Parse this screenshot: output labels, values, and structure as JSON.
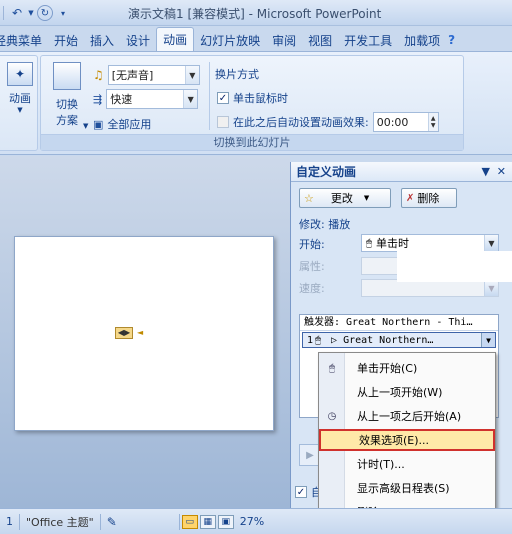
{
  "window": {
    "title": "演示文稿1 [兼容模式] - Microsoft PowerPoint"
  },
  "qat": {
    "undo_icon": "undo-icon",
    "redo_icon": "redo-icon",
    "customize_icon": "qat-dropdown-icon"
  },
  "tabs": [
    {
      "label": "经典菜单"
    },
    {
      "label": "开始"
    },
    {
      "label": "插入"
    },
    {
      "label": "设计"
    },
    {
      "label": "动画"
    },
    {
      "label": "幻灯片放映"
    },
    {
      "label": "审阅"
    },
    {
      "label": "视图"
    },
    {
      "label": "开发工具"
    },
    {
      "label": "加载项"
    }
  ],
  "active_tab": "动画",
  "ribbon": {
    "animation_btn": "动画",
    "transition_scheme_line1": "切换",
    "transition_scheme_line2": "方案",
    "sound_value": "[无声音]",
    "speed_value": "快速",
    "apply_all": "全部应用",
    "advance_title": "换片方式",
    "on_click": "单击鼠标时",
    "auto_after": "在此之后自动设置动画效果:",
    "auto_time": "00:00",
    "group_label": "切换到此幻灯片"
  },
  "pane": {
    "title": "自定义动画",
    "change_btn": "更改",
    "remove_btn": "删除",
    "modify_label": "修改: 播放",
    "start_label": "开始:",
    "start_value": "单击时",
    "property_label": "属性:",
    "speed_label": "速度:",
    "trigger_text": "触发器: Great Northern - Thi…",
    "item_index": "1",
    "item_text": "Great Northern…",
    "bottom_checkbox": "自"
  },
  "context_menu": {
    "items": [
      {
        "label": "单击开始(C)",
        "icon": "mouse-click-icon"
      },
      {
        "label": "从上一项开始(W)",
        "icon": ""
      },
      {
        "label": "从上一项之后开始(A)",
        "icon": "clock-icon"
      },
      {
        "label": "效果选项(E)...",
        "icon": "",
        "highlighted": true
      },
      {
        "label": "计时(T)...",
        "icon": ""
      },
      {
        "label": "显示高级日程表(S)",
        "icon": ""
      },
      {
        "label": "删除(R)",
        "icon": ""
      }
    ]
  },
  "status": {
    "slide_info": "1",
    "theme": "\"Office 主题\"",
    "zoom": "27%"
  }
}
